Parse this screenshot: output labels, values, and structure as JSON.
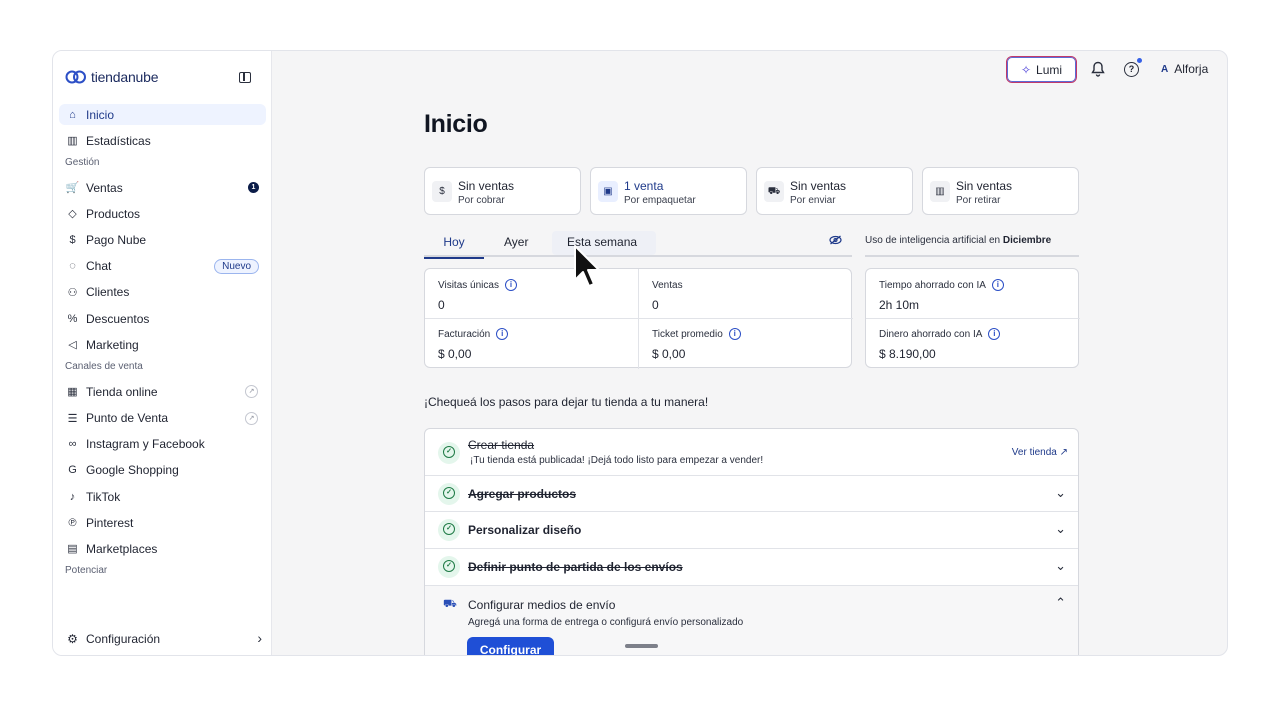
{
  "brand": {
    "name": "tiendanube"
  },
  "sidebar": {
    "top": [
      {
        "label": "Inicio",
        "icon": "home-icon",
        "glyph": "⌂",
        "active": true
      },
      {
        "label": "Estadísticas",
        "icon": "bar-chart-icon",
        "glyph": "▥"
      }
    ],
    "sections": [
      {
        "title": "Gestión",
        "items": [
          {
            "label": "Ventas",
            "icon": "cart-icon",
            "glyph": "🛒",
            "badge": "1"
          },
          {
            "label": "Productos",
            "icon": "tag-icon",
            "glyph": "◇"
          },
          {
            "label": "Pago Nube",
            "icon": "dollar-icon",
            "glyph": "$"
          },
          {
            "label": "Chat",
            "icon": "chat-icon",
            "glyph": "◌",
            "tag": "Nuevo"
          },
          {
            "label": "Clientes",
            "icon": "users-icon",
            "glyph": "⚇"
          },
          {
            "label": "Descuentos",
            "icon": "discount-icon",
            "glyph": "%"
          },
          {
            "label": "Marketing",
            "icon": "megaphone-icon",
            "glyph": "◁"
          }
        ]
      },
      {
        "title": "Canales de venta",
        "items": [
          {
            "label": "Tienda online",
            "icon": "store-icon",
            "glyph": "▦",
            "external": true
          },
          {
            "label": "Punto de Venta",
            "icon": "pos-icon",
            "glyph": "☰",
            "external": true
          },
          {
            "label": "Instagram y Facebook",
            "icon": "meta-icon",
            "glyph": "∞"
          },
          {
            "label": "Google Shopping",
            "icon": "google-icon",
            "glyph": "G"
          },
          {
            "label": "TikTok",
            "icon": "tiktok-icon",
            "glyph": "♪"
          },
          {
            "label": "Pinterest",
            "icon": "pinterest-icon",
            "glyph": "℗"
          },
          {
            "label": "Marketplaces",
            "icon": "marketplace-icon",
            "glyph": "▤"
          }
        ]
      },
      {
        "title": "Potenciar",
        "items": []
      }
    ],
    "config_label": "Configuración"
  },
  "topbar": {
    "lumi_label": "Lumi",
    "user_initial": "A",
    "user_name": "Alforja"
  },
  "page": {
    "title": "Inicio",
    "summary": [
      {
        "title": "Sin ventas",
        "sub": "Por cobrar",
        "icon": "dollar-icon",
        "glyph": "$"
      },
      {
        "title": "1 venta",
        "sub": "Por empaquetar",
        "icon": "box-icon",
        "glyph": "▣",
        "highlight": true
      },
      {
        "title": "Sin ventas",
        "sub": "Por enviar",
        "icon": "truck-icon",
        "glyph": "⛟"
      },
      {
        "title": "Sin ventas",
        "sub": "Por retirar",
        "icon": "store-icon",
        "glyph": "▥"
      }
    ],
    "tabs": [
      "Hoy",
      "Ayer",
      "Esta semana"
    ],
    "metrics": [
      {
        "label": "Visitas únicas",
        "value": "0",
        "info": true
      },
      {
        "label": "Ventas",
        "value": "0",
        "info": false
      },
      {
        "label": "Facturación",
        "value": "$ 0,00",
        "info": true
      },
      {
        "label": "Ticket promedio",
        "value": "$ 0,00",
        "info": true
      }
    ],
    "ai": {
      "title_prefix": "Uso de inteligencia artificial en",
      "month": "Diciembre",
      "metrics": [
        {
          "label": "Tiempo ahorrado con IA",
          "value": "2h 10m"
        },
        {
          "label": "Dinero ahorrado con IA",
          "value": "$ 8.190,00"
        }
      ]
    },
    "steps_title": "¡Chequeá los pasos para dejar tu tienda a tu manera!",
    "steps": [
      {
        "title": "Crear tienda",
        "sub": "¡Tu tienda está publicada! ¡Dejá todo listo para empezar a vender!",
        "done": true,
        "link": "Ver tienda"
      },
      {
        "title": "Agregar productos",
        "done": true
      },
      {
        "title": "Personalizar diseño",
        "done": false,
        "checked": true
      },
      {
        "title": "Definir punto de partida de los envíos",
        "done": true
      },
      {
        "title": "Configurar medios de envío",
        "sub": "Agregá una forma de entrega o configurá envío personalizado",
        "open": true,
        "button": "Configurar"
      }
    ]
  }
}
